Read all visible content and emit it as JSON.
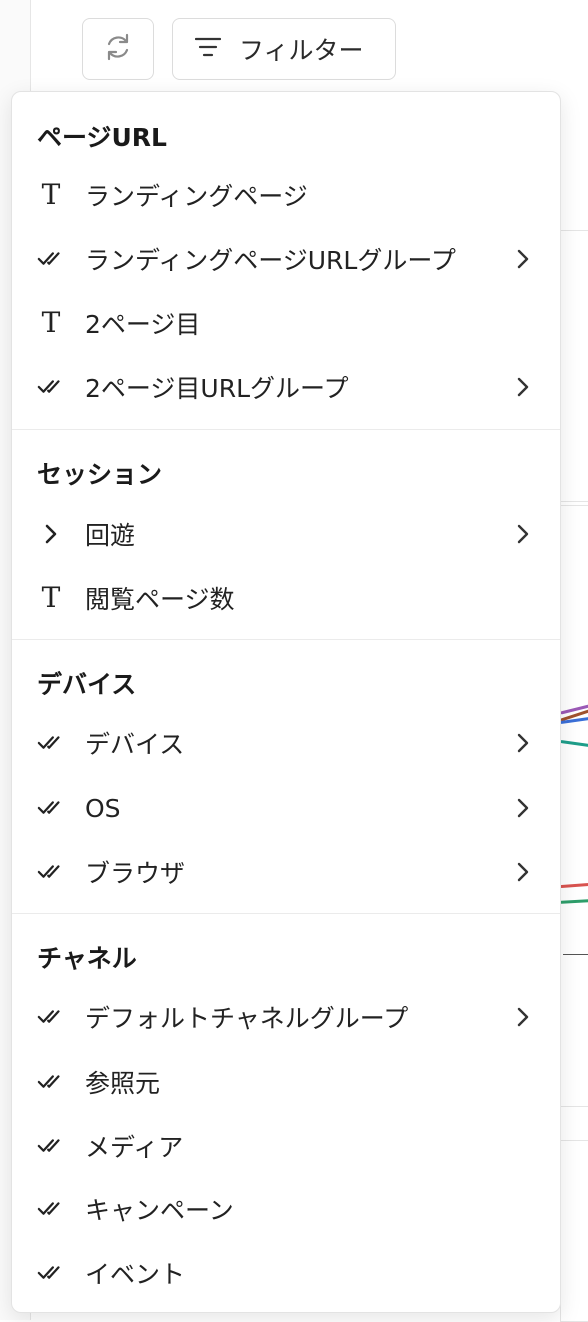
{
  "toolbar": {
    "filter_label": "フィルター",
    "refresh_icon": "refresh-icon",
    "filter_icon": "filter-icon"
  },
  "menu": {
    "sections": [
      {
        "title": "ページURL",
        "items": [
          {
            "label": "ランディングページ",
            "icon": "text-type-icon",
            "has_submenu": false
          },
          {
            "label": "ランディングページURLグループ",
            "icon": "double-check-icon",
            "has_submenu": true
          },
          {
            "label": "2ページ目",
            "icon": "text-type-icon",
            "has_submenu": false
          },
          {
            "label": "2ページ目URLグループ",
            "icon": "double-check-icon",
            "has_submenu": true
          }
        ]
      },
      {
        "title": "セッション",
        "items": [
          {
            "label": "回遊",
            "icon": "chevron-right-icon",
            "has_submenu": true
          },
          {
            "label": "閲覧ページ数",
            "icon": "text-type-icon",
            "has_submenu": false
          }
        ]
      },
      {
        "title": "デバイス",
        "items": [
          {
            "label": "デバイス",
            "icon": "double-check-icon",
            "has_submenu": true
          },
          {
            "label": "OS",
            "icon": "double-check-icon",
            "has_submenu": true
          },
          {
            "label": "ブラウザ",
            "icon": "double-check-icon",
            "has_submenu": true
          }
        ]
      },
      {
        "title": "チャネル",
        "items": [
          {
            "label": "デフォルトチャネルグループ",
            "icon": "double-check-icon",
            "has_submenu": true
          },
          {
            "label": "参照元",
            "icon": "double-check-icon",
            "has_submenu": false
          },
          {
            "label": "メディア",
            "icon": "double-check-icon",
            "has_submenu": false
          },
          {
            "label": "キャンペーン",
            "icon": "double-check-icon",
            "has_submenu": false
          },
          {
            "label": "イベント",
            "icon": "double-check-icon",
            "has_submenu": false
          }
        ]
      }
    ]
  },
  "colors": {
    "chart_purple": "#9b59b6",
    "chart_brown": "#a0522d",
    "chart_blue": "#3a6fd8",
    "chart_teal": "#1f9e8a",
    "chart_red": "#d9534f",
    "chart_green": "#2e9e6a"
  }
}
